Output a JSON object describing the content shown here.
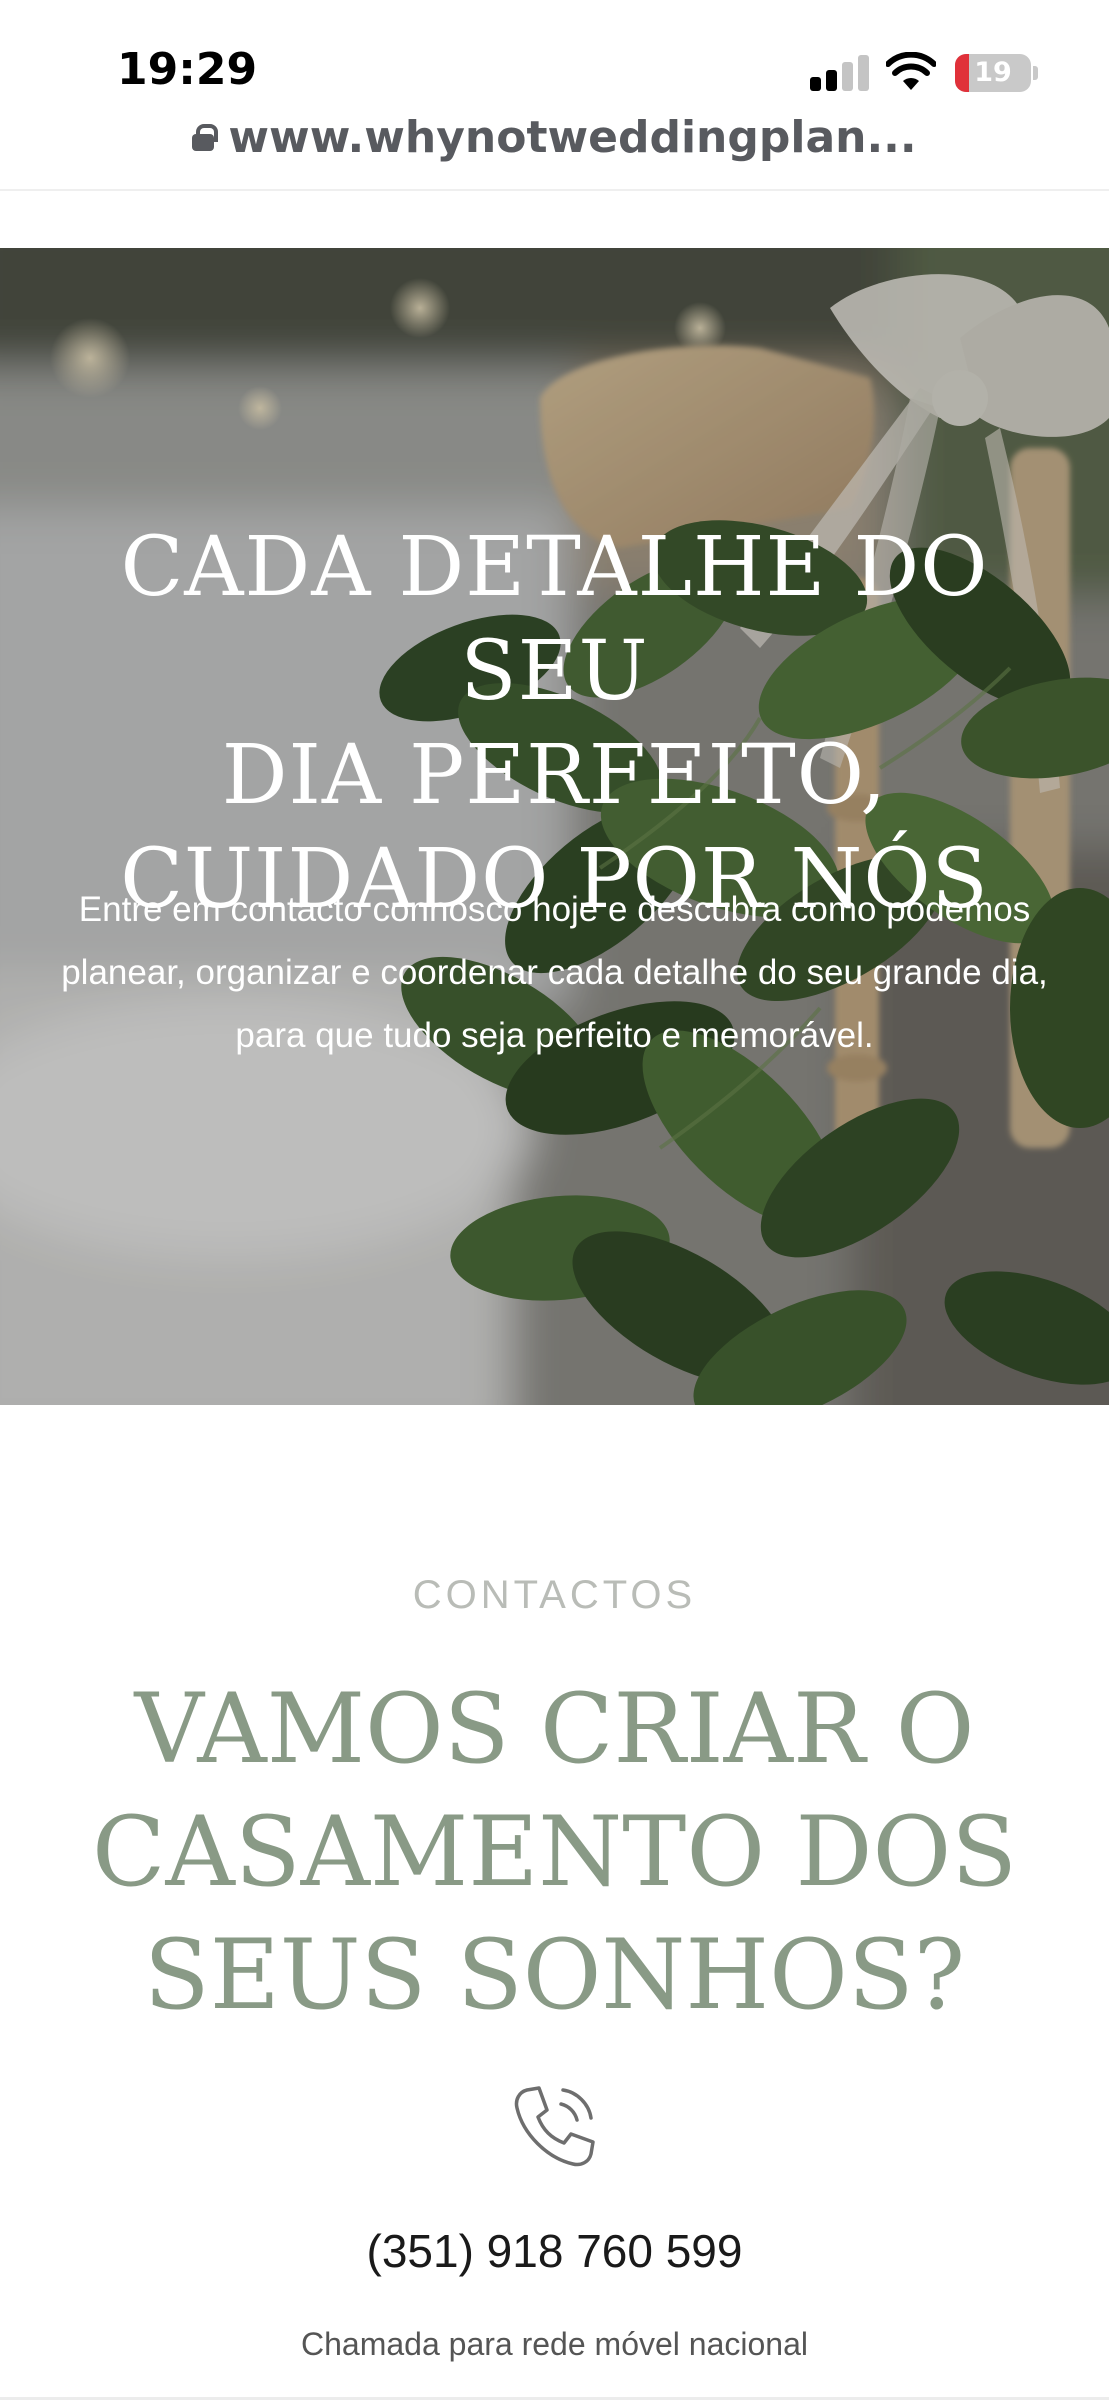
{
  "status_bar": {
    "time": "19:29",
    "battery_level": "19",
    "battery_fraction": 0.19
  },
  "browser": {
    "url": "www.whynotweddingplan..."
  },
  "hero": {
    "title_lines": [
      "CADA DETALHE DO SEU",
      "DIA PERFEITO,",
      "CUIDADO POR NÓS"
    ],
    "text": "Entre em contacto connosco hoje e descubra como podemos planear, organizar e coordenar cada detalhe do seu grande dia, para que tudo seja perfeito e memorável."
  },
  "contacts": {
    "eyebrow": "CONTACTOS",
    "title_lines": [
      "VAMOS CRIAR O",
      "CASAMENTO DOS",
      "SEUS SONHOS?"
    ],
    "phone_number": "(351) 918 760 599",
    "phone_note": "Chamada para rede móvel nacional"
  },
  "icons": {
    "lock": "lock-icon",
    "signal": "cellular-signal-icon",
    "wifi": "wifi-icon",
    "battery": "battery-icon",
    "phone": "phone-ringing-icon"
  },
  "colors": {
    "title_green": "#899a86",
    "eyebrow_grey": "#b9bcb7",
    "battery_low": "#e0313a"
  }
}
